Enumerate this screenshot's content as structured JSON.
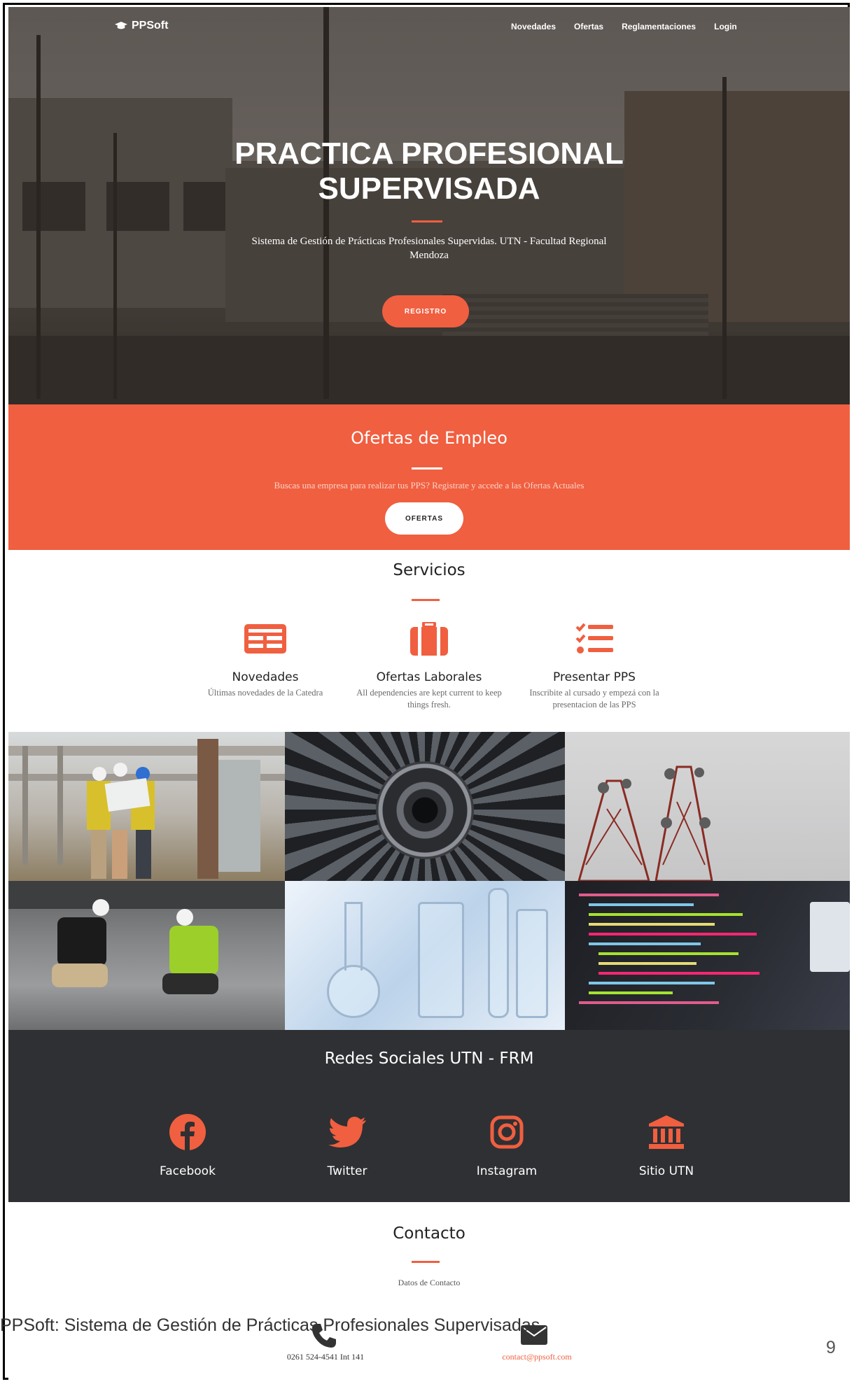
{
  "nav": {
    "brand": "PPSoft",
    "links": [
      "Novedades",
      "Ofertas",
      "Reglamentaciones",
      "Login"
    ]
  },
  "hero": {
    "title_line1": "PRACTICA PROFESIONAL",
    "title_line2": "SUPERVISADA",
    "subtitle": "Sistema de Gestión de Prácticas Profesionales Supervidas. UTN - Facultad Regional Mendoza",
    "button": "REGISTRO"
  },
  "ofertas": {
    "title": "Ofertas de Empleo",
    "text": "Buscas una empresa para realizar tus PPS? Registrate y accede a las Ofertas Actuales",
    "button": "OFERTAS"
  },
  "servicios": {
    "title": "Servicios",
    "items": [
      {
        "icon": "newspaper-icon",
        "title": "Novedades",
        "desc": "Últimas novedades de la Catedra"
      },
      {
        "icon": "suitcase-icon",
        "title": "Ofertas Laborales",
        "desc": "All dependencies are kept current to keep things fresh."
      },
      {
        "icon": "tasks-icon",
        "title": "Presentar PPS",
        "desc": "Inscribite al cursado y empezá con la presentacion de las PPS"
      }
    ]
  },
  "redes": {
    "title": "Redes Sociales UTN - FRM",
    "items": [
      {
        "icon": "facebook-icon",
        "label": "Facebook"
      },
      {
        "icon": "twitter-icon",
        "label": "Twitter"
      },
      {
        "icon": "instagram-icon",
        "label": "Instagram"
      },
      {
        "icon": "university-icon",
        "label": "Sitio UTN"
      }
    ]
  },
  "contacto": {
    "title": "Contacto",
    "subtitle": "Datos de Contacto",
    "phone": "0261 524-4541 Int 141",
    "email": "contact@ppsoft.com"
  },
  "doc": {
    "caption": "PPSoft: Sistema de Gestión de Prácticas Profesionales Supervisadas",
    "page_number": "9"
  },
  "colors": {
    "accent": "#f05f40",
    "dark": "#2f3033"
  }
}
